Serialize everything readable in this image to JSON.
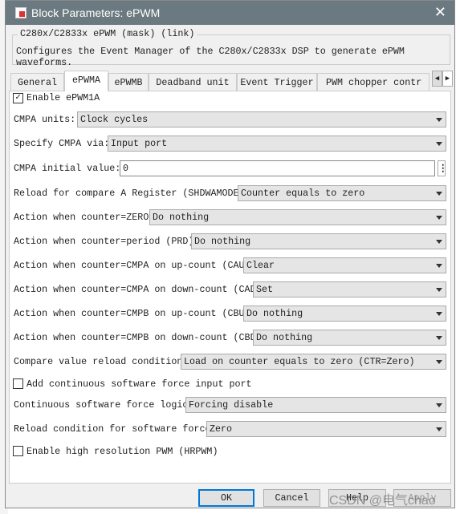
{
  "window": {
    "title": "Block Parameters: ePWM",
    "close_icon": "close-icon"
  },
  "mask": {
    "legend": "C280x/C2833x ePWM (mask) (link)",
    "description": "Configures the Event Manager of the C280x/C2833x DSP to generate ePWM waveforms."
  },
  "tabs": [
    {
      "label": "General"
    },
    {
      "label": "ePWMA",
      "active": true
    },
    {
      "label": "ePWMB"
    },
    {
      "label": "Deadband unit"
    },
    {
      "label": "Event Trigger"
    },
    {
      "label": "PWM chopper contr"
    }
  ],
  "params": {
    "enable": {
      "label": "Enable ePWM1A",
      "checked": true
    },
    "cmpa_units": {
      "label": "CMPA units:",
      "value": "Clock cycles"
    },
    "specify_cmpa": {
      "label": "Specify CMPA via:",
      "value": "Input port"
    },
    "cmpa_initial": {
      "label": "CMPA initial value:",
      "value": "0"
    },
    "reload_a": {
      "label": "Reload for compare A Register (SHDWAMODE):",
      "value": "Counter equals to zero"
    },
    "zero": {
      "label": "Action when counter=ZERO:",
      "value": "Do nothing"
    },
    "prd": {
      "label": "Action when counter=period (PRD):",
      "value": "Do nothing"
    },
    "cau": {
      "label": "Action when counter=CMPA on up-count (CAU):",
      "value": "Clear"
    },
    "cad": {
      "label": "Action when counter=CMPA on down-count (CAD):",
      "value": "Set"
    },
    "cbu": {
      "label": "Action when counter=CMPB on up-count (CBU):",
      "value": "Do nothing"
    },
    "cbd": {
      "label": "Action when counter=CMPB on down-count (CBD):",
      "value": "Do nothing"
    },
    "compare_reload": {
      "label": "Compare value reload condition:",
      "value": "Load on counter equals to zero (CTR=Zero)"
    },
    "add_force": {
      "label": "Add continuous software force input port",
      "checked": false
    },
    "force_logic": {
      "label": "Continuous software force logic:",
      "value": "Forcing disable"
    },
    "force_reload": {
      "label": "Reload condition for software force:",
      "value": "Zero"
    },
    "hrpwm": {
      "label": "Enable high resolution PWM (HRPWM)",
      "checked": false
    }
  },
  "buttons": {
    "ok": "OK",
    "cancel": "Cancel",
    "help": "Help",
    "apply": "Apply"
  },
  "watermark": "CSDN @电气chao"
}
